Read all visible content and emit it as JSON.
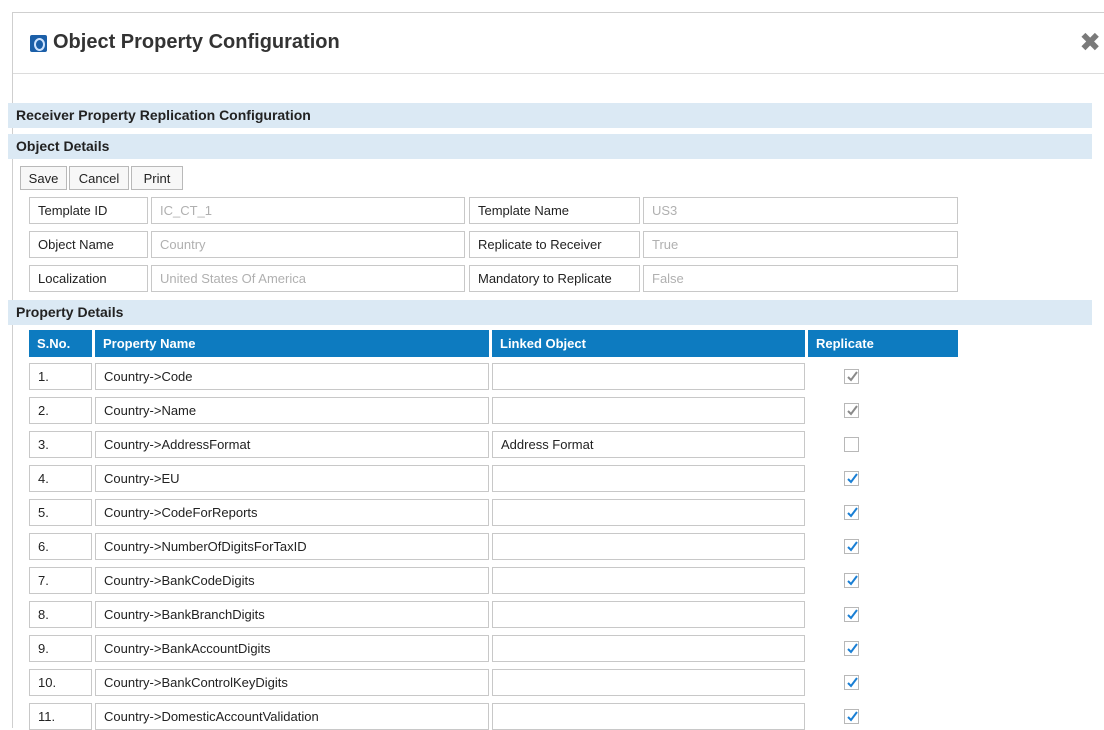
{
  "dialog": {
    "title": "Object Property Configuration"
  },
  "sections": {
    "replication": "Receiver Property Replication Configuration",
    "object_details": "Object Details",
    "property_details": "Property Details"
  },
  "toolbar": {
    "save_label": "Save",
    "cancel_label": "Cancel",
    "print_label": "Print"
  },
  "object": {
    "template_id_label": "Template ID",
    "template_id_value": "IC_CT_1",
    "template_name_label": "Template Name",
    "template_name_value": "US3",
    "object_name_label": "Object Name",
    "object_name_value": "Country",
    "replicate_label": "Replicate to Receiver",
    "replicate_value": "True",
    "localization_label": "Localization",
    "localization_value": "United States Of America",
    "mandatory_label": "Mandatory to Replicate",
    "mandatory_value": "False"
  },
  "table": {
    "headers": {
      "sno": "S.No.",
      "property": "Property Name",
      "linked": "Linked Object",
      "replicate": "Replicate"
    },
    "rows": [
      {
        "sno": "1.",
        "property": "Country->Code",
        "linked": "",
        "checked": true,
        "disabled": true
      },
      {
        "sno": "2.",
        "property": "Country->Name",
        "linked": "",
        "checked": true,
        "disabled": true
      },
      {
        "sno": "3.",
        "property": "Country->AddressFormat",
        "linked": "Address Format",
        "checked": false,
        "disabled": true
      },
      {
        "sno": "4.",
        "property": "Country->EU",
        "linked": "",
        "checked": true,
        "disabled": false
      },
      {
        "sno": "5.",
        "property": "Country->CodeForReports",
        "linked": "",
        "checked": true,
        "disabled": false
      },
      {
        "sno": "6.",
        "property": "Country->NumberOfDigitsForTaxID",
        "linked": "",
        "checked": true,
        "disabled": false
      },
      {
        "sno": "7.",
        "property": "Country->BankCodeDigits",
        "linked": "",
        "checked": true,
        "disabled": false
      },
      {
        "sno": "8.",
        "property": "Country->BankBranchDigits",
        "linked": "",
        "checked": true,
        "disabled": false
      },
      {
        "sno": "9.",
        "property": "Country->BankAccountDigits",
        "linked": "",
        "checked": true,
        "disabled": false
      },
      {
        "sno": "10.",
        "property": "Country->BankControlKeyDigits",
        "linked": "",
        "checked": true,
        "disabled": false
      },
      {
        "sno": "11.",
        "property": "Country->DomesticAccountValidation",
        "linked": "",
        "checked": true,
        "disabled": false
      }
    ]
  },
  "colors": {
    "header_bg": "#0d7bc0",
    "band_bg": "#dbe9f4",
    "check_active": "#1a7fd4",
    "check_disabled": "#8a8a8a"
  },
  "icons": {
    "app": "app-logo-icon",
    "close": "close-icon",
    "check": "checkmark-icon"
  }
}
